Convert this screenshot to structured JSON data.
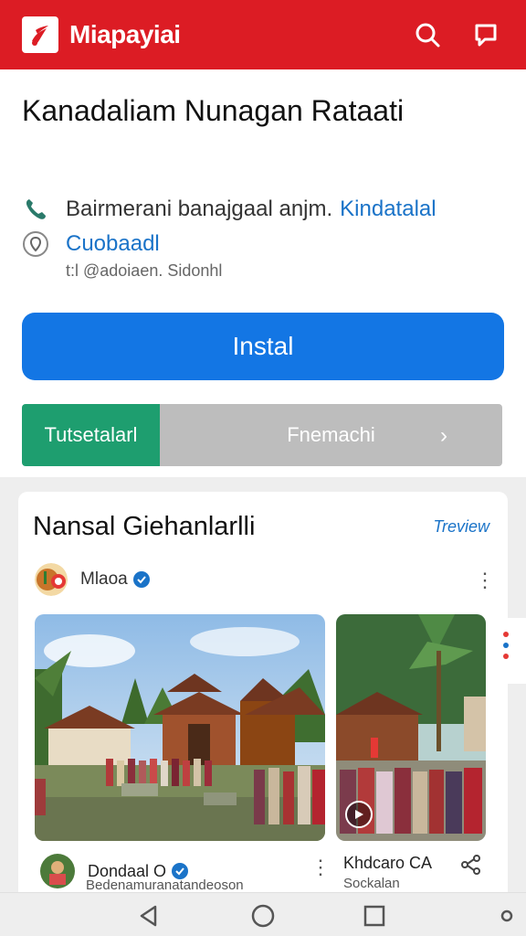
{
  "header": {
    "title": "Miapayiai",
    "logo_icon": "brand-logo-icon",
    "search_icon": "search-icon",
    "chat_icon": "chat-icon",
    "brand_color": "#dc1c24"
  },
  "app": {
    "title": "Kanadaliam Nunagan Rataati",
    "info_line_1_text": "Bairmerani banajgaal anjm.",
    "info_line_1_link": "Kindatalal",
    "info_line_1_icon": "phone-icon",
    "info_line_2_link": "Cuobaadl",
    "info_line_2_icon": "location-icon",
    "info_note": "t:l @adoiaen. Sidonhl"
  },
  "actions": {
    "install_label": "Instal",
    "install_color": "#1376e4",
    "split_left_label": "Tutsetalarl",
    "split_right_label": "Fnemachi",
    "split_chevron": "›",
    "split_left_color": "#1e9e6f"
  },
  "section": {
    "title": "Nansal Giehanlarlli",
    "link_label": "Treview",
    "author_name": "Mlaoa",
    "author_avatar": "avatar",
    "kebab": "⋮",
    "photo_1": "temple-gathering-photo",
    "photo_2": "palm-procession-photo",
    "caption_1_name": "Dondaal O",
    "caption_1_sub": "Bedenamuranatandeoson",
    "caption_2_name": "Khdcaro CA",
    "caption_2_sub": "Sockalan",
    "share_icon": "share-icon",
    "play_icon": "play-icon"
  },
  "navbar": {
    "back_icon": "back-icon",
    "home_icon": "home-icon",
    "recents_icon": "recents-icon",
    "dot_icon": "dot-icon"
  }
}
